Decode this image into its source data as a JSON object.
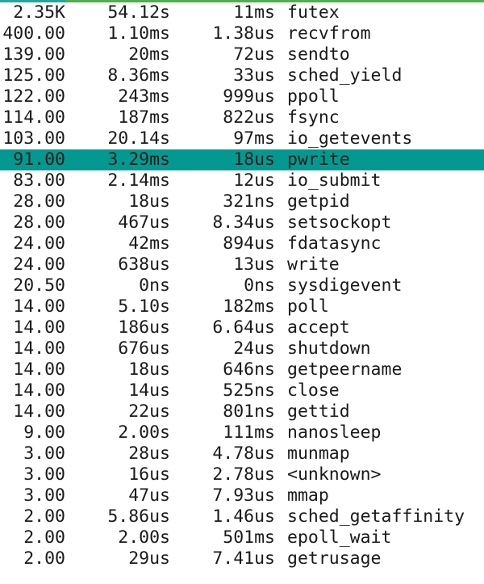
{
  "colors": {
    "selected_row_bg": "#049990",
    "top_bar": "#4caf50",
    "top_bar_segment": "#26a69a",
    "text": "#1a1a1a"
  },
  "selected_index": 7,
  "rows": [
    {
      "calls": "2.35K",
      "time": "54.12s",
      "avg": "11ms",
      "name": "futex"
    },
    {
      "calls": "400.00",
      "time": "1.10ms",
      "avg": "1.38us",
      "name": "recvfrom"
    },
    {
      "calls": "139.00",
      "time": "20ms",
      "avg": "72us",
      "name": "sendto"
    },
    {
      "calls": "125.00",
      "time": "8.36ms",
      "avg": "33us",
      "name": "sched_yield"
    },
    {
      "calls": "122.00",
      "time": "243ms",
      "avg": "999us",
      "name": "ppoll"
    },
    {
      "calls": "114.00",
      "time": "187ms",
      "avg": "822us",
      "name": "fsync"
    },
    {
      "calls": "103.00",
      "time": "20.14s",
      "avg": "97ms",
      "name": "io_getevents"
    },
    {
      "calls": "91.00",
      "time": "3.29ms",
      "avg": "18us",
      "name": "pwrite"
    },
    {
      "calls": "83.00",
      "time": "2.14ms",
      "avg": "12us",
      "name": "io_submit"
    },
    {
      "calls": "28.00",
      "time": "18us",
      "avg": "321ns",
      "name": "getpid"
    },
    {
      "calls": "28.00",
      "time": "467us",
      "avg": "8.34us",
      "name": "setsockopt"
    },
    {
      "calls": "24.00",
      "time": "42ms",
      "avg": "894us",
      "name": "fdatasync"
    },
    {
      "calls": "24.00",
      "time": "638us",
      "avg": "13us",
      "name": "write"
    },
    {
      "calls": "20.50",
      "time": "0ns",
      "avg": "0ns",
      "name": "sysdigevent"
    },
    {
      "calls": "14.00",
      "time": "5.10s",
      "avg": "182ms",
      "name": "poll"
    },
    {
      "calls": "14.00",
      "time": "186us",
      "avg": "6.64us",
      "name": "accept"
    },
    {
      "calls": "14.00",
      "time": "676us",
      "avg": "24us",
      "name": "shutdown"
    },
    {
      "calls": "14.00",
      "time": "18us",
      "avg": "646ns",
      "name": "getpeername"
    },
    {
      "calls": "14.00",
      "time": "14us",
      "avg": "525ns",
      "name": "close"
    },
    {
      "calls": "14.00",
      "time": "22us",
      "avg": "801ns",
      "name": "gettid"
    },
    {
      "calls": "9.00",
      "time": "2.00s",
      "avg": "111ms",
      "name": "nanosleep"
    },
    {
      "calls": "3.00",
      "time": "28us",
      "avg": "4.78us",
      "name": "munmap"
    },
    {
      "calls": "3.00",
      "time": "16us",
      "avg": "2.78us",
      "name": "<unknown>"
    },
    {
      "calls": "3.00",
      "time": "47us",
      "avg": "7.93us",
      "name": "mmap"
    },
    {
      "calls": "2.00",
      "time": "5.86us",
      "avg": "1.46us",
      "name": "sched_getaffinity"
    },
    {
      "calls": "2.00",
      "time": "2.00s",
      "avg": "501ms",
      "name": "epoll_wait"
    },
    {
      "calls": "2.00",
      "time": "29us",
      "avg": "7.41us",
      "name": "getrusage"
    }
  ]
}
